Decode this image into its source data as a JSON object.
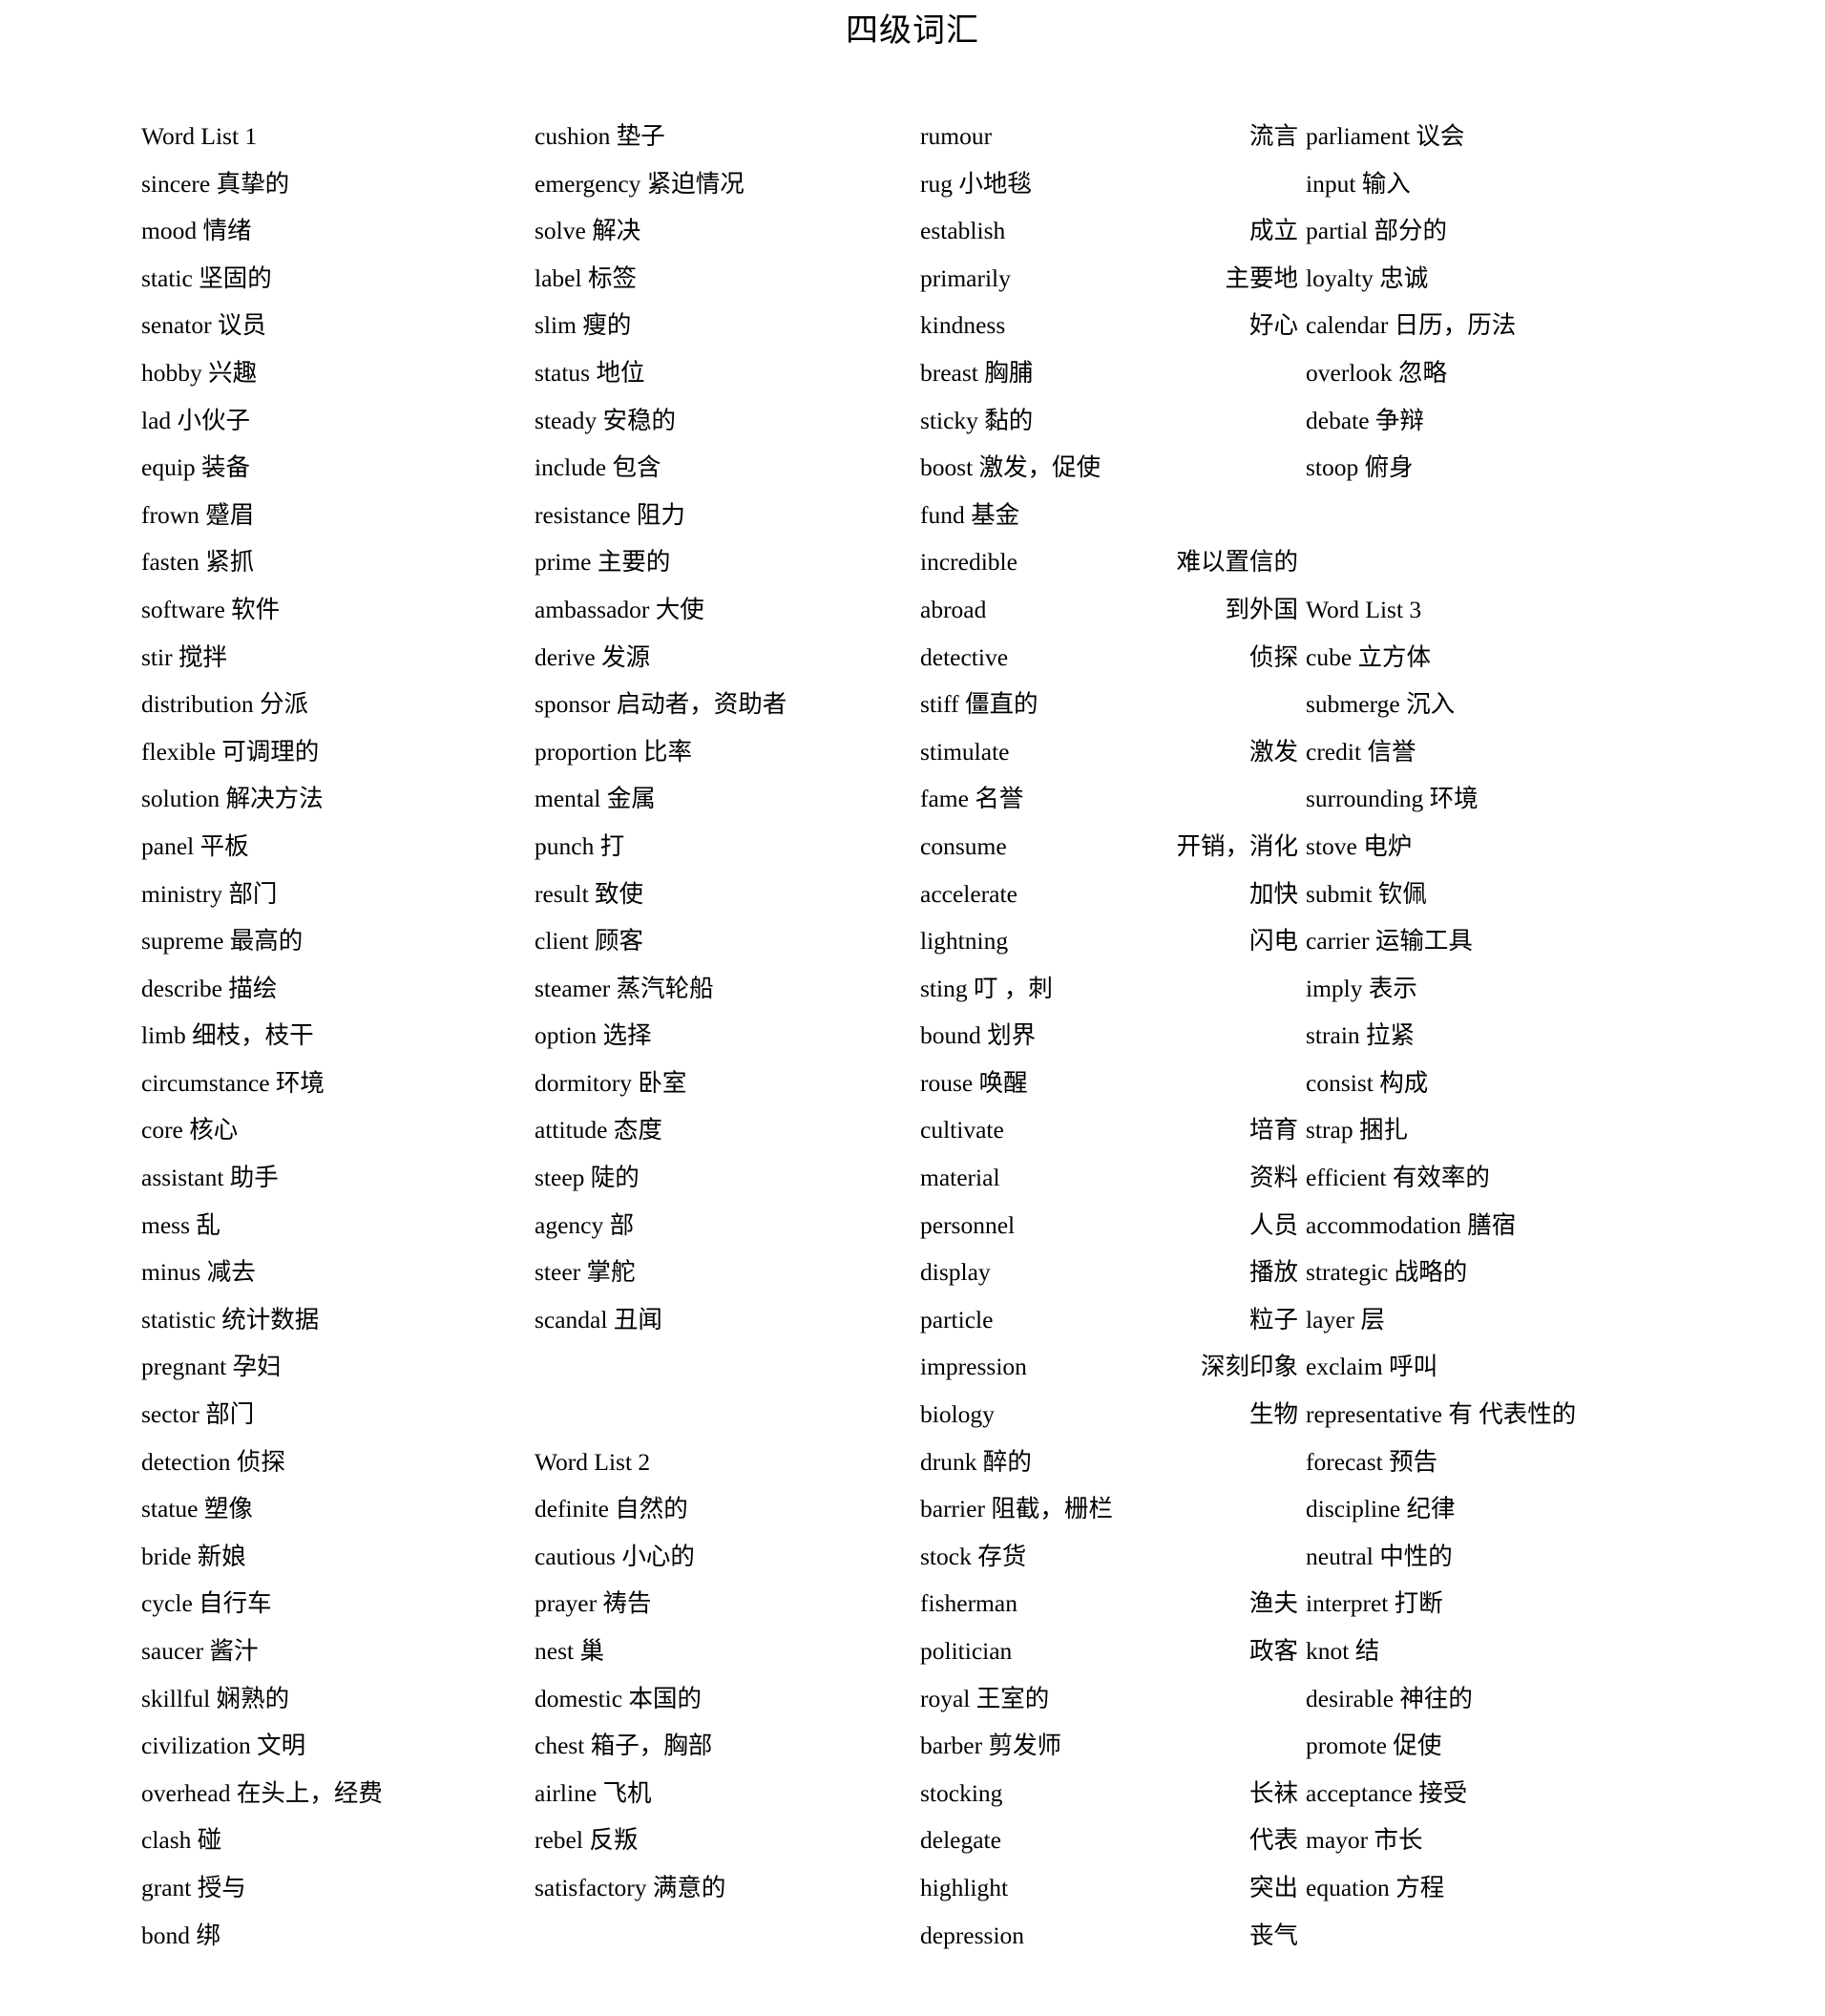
{
  "document": {
    "title": "四级词汇"
  },
  "columns": [
    {
      "name": "column-1",
      "entries": [
        {
          "en": "Word List 1",
          "cn": "",
          "heading": true
        },
        {
          "en": "sincere",
          "cn": "真挚的"
        },
        {
          "en": "mood",
          "cn": "情绪"
        },
        {
          "en": "static",
          "cn": "坚固的"
        },
        {
          "en": "senator",
          "cn": "议员"
        },
        {
          "en": "hobby",
          "cn": "兴趣"
        },
        {
          "en": "lad",
          "cn": "小伙子"
        },
        {
          "en": "equip",
          "cn": "装备"
        },
        {
          "en": "frown",
          "cn": "蹙眉"
        },
        {
          "en": "fasten",
          "cn": "紧抓"
        },
        {
          "en": "software",
          "cn": "软件"
        },
        {
          "en": "stir",
          "cn": "搅拌"
        },
        {
          "en": "distribution",
          "cn": "分派"
        },
        {
          "en": "flexible",
          "cn": "可调理的"
        },
        {
          "en": "solution",
          "cn": "解决方法"
        },
        {
          "en": "panel",
          "cn": "平板"
        },
        {
          "en": "ministry",
          "cn": "部门"
        },
        {
          "en": "supreme",
          "cn": "最高的"
        },
        {
          "en": "describe",
          "cn": "描绘"
        },
        {
          "en": "limb",
          "cn": "细枝，枝干"
        },
        {
          "en": "circumstance",
          "cn": "环境"
        },
        {
          "en": "core",
          "cn": "核心"
        },
        {
          "en": "assistant",
          "cn": "助手"
        },
        {
          "en": "mess",
          "cn": "乱"
        },
        {
          "en": "minus",
          "cn": "减去"
        },
        {
          "en": "statistic",
          "cn": "统计数据"
        },
        {
          "en": "pregnant",
          "cn": "孕妇"
        },
        {
          "en": "sector",
          "cn": "部门"
        },
        {
          "en": "detection",
          "cn": "侦探"
        },
        {
          "en": "statue",
          "cn": "塑像"
        },
        {
          "en": "bride",
          "cn": "新娘"
        },
        {
          "en": "cycle",
          "cn": "自行车"
        },
        {
          "en": "saucer",
          "cn": "酱汁"
        },
        {
          "en": "skillful",
          "cn": "娴熟的"
        },
        {
          "en": "civilization",
          "cn": "文明"
        },
        {
          "en": "overhead",
          "cn": "在头上，经费"
        },
        {
          "en": "clash",
          "cn": "碰"
        },
        {
          "en": "grant",
          "cn": "授与"
        },
        {
          "en": "bond",
          "cn": "绑"
        }
      ]
    },
    {
      "name": "column-2",
      "entries": [
        {
          "en": "cushion",
          "cn": "垫子"
        },
        {
          "en": "emergency",
          "cn": "紧迫情况"
        },
        {
          "en": "solve",
          "cn": "解决"
        },
        {
          "en": "label",
          "cn": "标签"
        },
        {
          "en": "slim",
          "cn": "瘦的"
        },
        {
          "en": "status",
          "cn": "地位"
        },
        {
          "en": "steady",
          "cn": "安稳的"
        },
        {
          "en": "include",
          "cn": "包含"
        },
        {
          "en": "resistance",
          "cn": "阻力"
        },
        {
          "en": "prime",
          "cn": "主要的"
        },
        {
          "en": "ambassador",
          "cn": "大使"
        },
        {
          "en": "derive",
          "cn": "发源"
        },
        {
          "en": "sponsor",
          "cn": "启动者，资助者",
          "wrap": true
        },
        {
          "en": "proportion",
          "cn": "比率"
        },
        {
          "en": "mental",
          "cn": "金属"
        },
        {
          "en": "punch",
          "cn": "打"
        },
        {
          "en": "result",
          "cn": "致使"
        },
        {
          "en": "client",
          "cn": "顾客"
        },
        {
          "en": "steamer",
          "cn": "蒸汽轮船"
        },
        {
          "en": "option",
          "cn": "选择"
        },
        {
          "en": "dormitory",
          "cn": "卧室"
        },
        {
          "en": "attitude",
          "cn": "态度"
        },
        {
          "en": "steep",
          "cn": "陡的"
        },
        {
          "en": "agency",
          "cn": "部"
        },
        {
          "en": "steer",
          "cn": "掌舵"
        },
        {
          "en": "scandal",
          "cn": "丑闻"
        },
        {
          "en": "",
          "cn": "",
          "blank": true
        },
        {
          "en": "",
          "cn": "",
          "blank": true
        },
        {
          "en": "Word List 2",
          "cn": "",
          "heading": true
        },
        {
          "en": "definite",
          "cn": "自然的"
        },
        {
          "en": "cautious",
          "cn": "小心的"
        },
        {
          "en": "prayer",
          "cn": "祷告"
        },
        {
          "en": "nest",
          "cn": "巢"
        },
        {
          "en": "domestic",
          "cn": "本国的"
        },
        {
          "en": "chest",
          "cn": "箱子，胸部"
        },
        {
          "en": "airline",
          "cn": "飞机"
        },
        {
          "en": "rebel",
          "cn": "反叛"
        },
        {
          "en": "satisfactory",
          "cn": "满意的"
        }
      ]
    },
    {
      "name": "column-3",
      "entries": [
        {
          "en": "rumour",
          "cn": "流言"
        },
        {
          "en": "rug",
          "cn": "小地毯",
          "tight": true
        },
        {
          "en": "establish",
          "cn": "成立"
        },
        {
          "en": "primarily",
          "cn": "主要地"
        },
        {
          "en": "kindness",
          "cn": "好心"
        },
        {
          "en": "breast",
          "cn": "胸脯",
          "tight": true
        },
        {
          "en": "sticky",
          "cn": "黏的",
          "tight": true
        },
        {
          "en": "boost",
          "cn": "激发，促使",
          "tight": true
        },
        {
          "en": "fund",
          "cn": "基金",
          "tight": true
        },
        {
          "en": "incredible",
          "cn": "难以置信的"
        },
        {
          "en": "abroad",
          "cn": "到外国"
        },
        {
          "en": "detective",
          "cn": "侦探"
        },
        {
          "en": "stiff",
          "cn": "僵直的",
          "tight": true
        },
        {
          "en": "stimulate",
          "cn": "激发"
        },
        {
          "en": "fame",
          "cn": "名誉",
          "tight": true
        },
        {
          "en": "consume",
          "cn": "开销，消化"
        },
        {
          "en": "accelerate",
          "cn": "加快"
        },
        {
          "en": "lightning",
          "cn": "闪电"
        },
        {
          "en": "sting",
          "cn": "叮        ，刺",
          "tight": true
        },
        {
          "en": "bound",
          "cn": "划界",
          "tight": true
        },
        {
          "en": "rouse",
          "cn": "唤醒",
          "tight": true
        },
        {
          "en": "cultivate",
          "cn": "培育"
        },
        {
          "en": "material",
          "cn": "资料"
        },
        {
          "en": "personnel",
          "cn": "人员"
        },
        {
          "en": "display",
          "cn": "播放"
        },
        {
          "en": "particle",
          "cn": "粒子"
        },
        {
          "en": "impression",
          "cn": "深刻印象"
        },
        {
          "en": "biology",
          "cn": "生物"
        },
        {
          "en": "drunk",
          "cn": "醉的",
          "tight": true
        },
        {
          "en": "barrier",
          "cn": "阻截，栅栏",
          "tight": true
        },
        {
          "en": "stock",
          "cn": "存货",
          "tight": true
        },
        {
          "en": "fisherman",
          "cn": "渔夫"
        },
        {
          "en": "politician",
          "cn": "政客"
        },
        {
          "en": "royal",
          "cn": "王室的",
          "tight": true
        },
        {
          "en": "barber",
          "cn": "剪发师",
          "tight": true
        },
        {
          "en": "stocking",
          "cn": "长袜"
        },
        {
          "en": "delegate",
          "cn": "代表"
        },
        {
          "en": "highlight",
          "cn": "突出"
        },
        {
          "en": "depression",
          "cn": "丧气"
        }
      ]
    },
    {
      "name": "column-4",
      "entries": [
        {
          "en": "parliament",
          "cn": "议会"
        },
        {
          "en": "input",
          "cn": "输入"
        },
        {
          "en": "partial",
          "cn": "部分的"
        },
        {
          "en": "loyalty",
          "cn": "忠诚"
        },
        {
          "en": "calendar",
          "cn": "日历，历法"
        },
        {
          "en": "overlook",
          "cn": "忽略"
        },
        {
          "en": "debate",
          "cn": "争辩"
        },
        {
          "en": "stoop",
          "cn": "俯身"
        },
        {
          "en": "",
          "cn": "",
          "blank": true
        },
        {
          "en": "",
          "cn": "",
          "blank": true
        },
        {
          "en": "Word List 3",
          "cn": "",
          "heading": true
        },
        {
          "en": "cube",
          "cn": "立方体"
        },
        {
          "en": "submerge",
          "cn": "沉入"
        },
        {
          "en": "credit",
          "cn": "信誉"
        },
        {
          "en": "surrounding",
          "cn": "环境"
        },
        {
          "en": "stove",
          "cn": "电炉"
        },
        {
          "en": "submit",
          "cn": "钦佩"
        },
        {
          "en": "carrier",
          "cn": "运输工具"
        },
        {
          "en": "imply",
          "cn": "表示"
        },
        {
          "en": "strain",
          "cn": "拉紧"
        },
        {
          "en": "consist",
          "cn": "构成"
        },
        {
          "en": "strap",
          "cn": "捆扎"
        },
        {
          "en": "efficient",
          "cn": "有效率的"
        },
        {
          "en": "accommodation",
          "cn": "膳宿"
        },
        {
          "en": "strategic",
          "cn": "战略的"
        },
        {
          "en": "layer",
          "cn": "层"
        },
        {
          "en": "exclaim",
          "cn": "呼叫"
        },
        {
          "en": "representative",
          "cn": "有 代表性的",
          "wrap": true
        },
        {
          "en": "forecast",
          "cn": "预告"
        },
        {
          "en": "discipline",
          "cn": "纪律"
        },
        {
          "en": "neutral",
          "cn": "中性的"
        },
        {
          "en": "interpret",
          "cn": "打断"
        },
        {
          "en": "knot",
          "cn": "结"
        },
        {
          "en": "desirable",
          "cn": "神往的"
        },
        {
          "en": "promote",
          "cn": "促使"
        },
        {
          "en": "acceptance",
          "cn": "接受"
        },
        {
          "en": "mayor",
          "cn": "市长"
        },
        {
          "en": "equation",
          "cn": "方程"
        }
      ]
    }
  ]
}
